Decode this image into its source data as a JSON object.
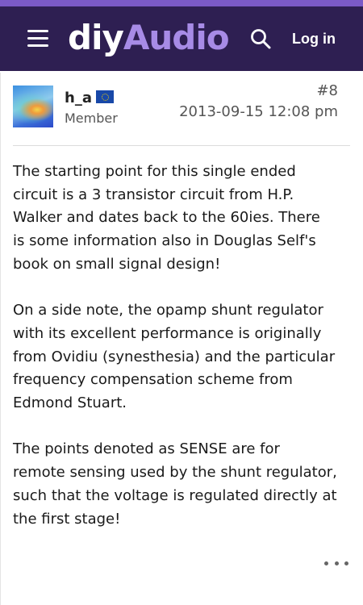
{
  "header": {
    "logo_part1": "diy",
    "logo_part2": "Audio",
    "login_label": "Log in",
    "menu_icon": "hamburger-menu-icon",
    "search_icon": "search-icon",
    "background_color": "#2e1f52",
    "accent_color": "#7b5ac7",
    "logo_accent_color": "#a78be6"
  },
  "post": {
    "author": {
      "name": "h_a",
      "title": "Member",
      "flag_icon": "eu-flag-icon"
    },
    "number": "#8",
    "date": "2013-09-15 12:08 pm",
    "body": {
      "paragraph1": [
        "The starting point for this single ended",
        "circuit is a 3 transistor circuit from H.P.",
        "Walker and dates back to the 60ies. There",
        "is some information also in Douglas Self's",
        "book on small signal design!"
      ],
      "paragraph2": [
        "On a side note, the opamp shunt regulator",
        "with its excellent performance is originally",
        "from Ovidiu (synesthesia) and the particular",
        "frequency compensation scheme from",
        "Edmond Stuart."
      ],
      "paragraph3": [
        "The points denoted as SENSE are for",
        "remote sensing used by the shunt regulator,",
        "such that the voltage is regulated directly at",
        "the first stage!"
      ]
    },
    "more_icon": "more-options-icon"
  }
}
